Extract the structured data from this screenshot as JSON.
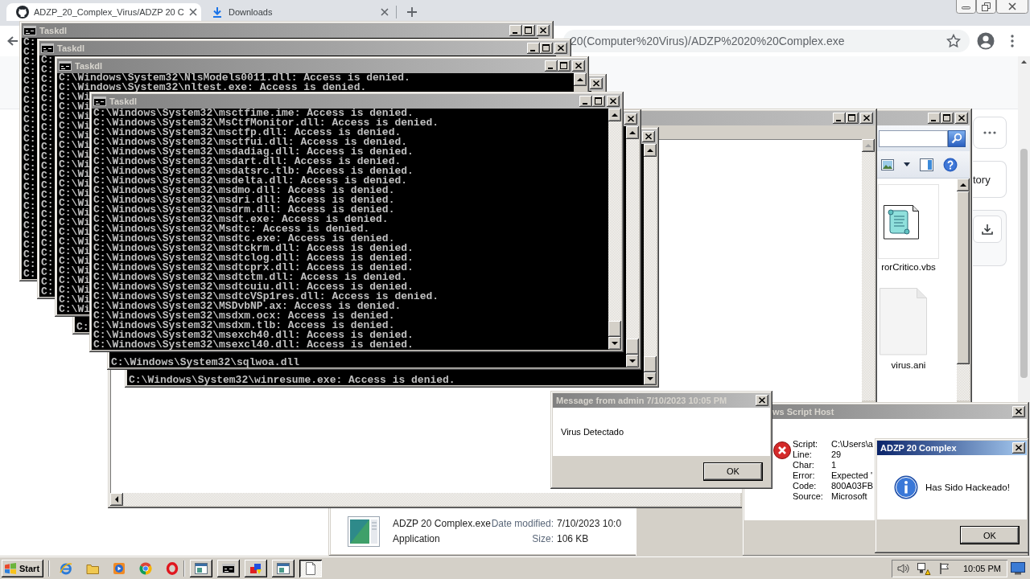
{
  "browser": {
    "tabs": [
      {
        "kind": "favicon",
        "title": "ADZP_20_Complex_Virus/ADZP 20 C",
        "selected": true
      },
      {
        "kind": "download",
        "title": "Downloads",
        "selected": false
      }
    ],
    "url": "20(Computer%20Virus)/ADZP%2020%20Complex.exe",
    "side_card": "tory"
  },
  "explorer": {
    "files": [
      {
        "kind": "script",
        "name": "rorCritico.vbs"
      },
      {
        "kind": "blank",
        "name": "virus.ani"
      }
    ],
    "details": {
      "name": "ADZP 20 Complex.exe",
      "date_label": "Date modified:",
      "date": "7/10/2023 10:0",
      "type": "Application",
      "size_label": "Size:",
      "size": "106 KB"
    }
  },
  "consoles": [
    {
      "title": "Taskdl",
      "lines": [
        "C:",
        "C:",
        "C:",
        "C:",
        "C:",
        "C:",
        "C:",
        "C:",
        "C:",
        "C:",
        "C:",
        "C:",
        "C:",
        "C:",
        "C:",
        "C:",
        "C:",
        "C:",
        "C:",
        "C:",
        "C:",
        "C:",
        "C:",
        "C:",
        "C:"
      ]
    },
    {
      "title": "Taskdl",
      "lines": [
        "C:",
        "C:",
        "C:",
        "C:",
        "C:",
        "C:",
        "C:",
        "C:",
        "C:",
        "C:",
        "C:",
        "C:",
        "C:",
        "C:",
        "C:",
        "C:",
        "C:",
        "C:",
        "C:",
        "C:",
        "C:",
        "C:",
        "C:",
        "C:",
        "C:"
      ]
    },
    {
      "title": "Taskdl",
      "lines": [
        "C:\\Windows\\System32\\NlsModels0011.dll: Access is denied.",
        "C:\\Windows\\System32\\nltest.exe: Access is denied.",
        "C:\\Wi",
        "C:\\Wi",
        "C:\\Wi",
        "C:\\Wi",
        "C:\\Wi",
        "C:\\Wi",
        "C:\\Wi",
        "C:\\Wi",
        "C:\\Wi",
        "C:\\Wi",
        "C:\\Wi",
        "C:\\Wi",
        "C:\\Wi",
        "C:\\Wi",
        "C:\\Wi",
        "C:\\Wi",
        "C:\\Wi",
        "C:\\Wi",
        "C:\\Wi",
        "C:\\Wi",
        "C:\\Wi",
        "C:\\Wi",
        "C:\\Wi"
      ]
    },
    {
      "lines": [
        "C:"
      ]
    },
    {
      "title": "Taskdl",
      "lines": [
        "C:\\Windows\\System32\\msctfime.ime: Access is denied.",
        "C:\\Windows\\System32\\MsCtfMonitor.dll: Access is denied.",
        "C:\\Windows\\System32\\msctfp.dll: Access is denied.",
        "C:\\Windows\\System32\\msctfui.dll: Access is denied.",
        "C:\\Windows\\System32\\msdadiag.dll: Access is denied.",
        "C:\\Windows\\System32\\msdart.dll: Access is denied.",
        "C:\\Windows\\System32\\msdatsrc.tlb: Access is denied.",
        "C:\\Windows\\System32\\msdelta.dll: Access is denied.",
        "C:\\Windows\\System32\\msdmo.dll: Access is denied.",
        "C:\\Windows\\System32\\msdri.dll: Access is denied.",
        "C:\\Windows\\System32\\msdrm.dll: Access is denied.",
        "C:\\Windows\\System32\\msdt.exe: Access is denied.",
        "C:\\Windows\\System32\\Msdtc: Access is denied.",
        "C:\\Windows\\System32\\msdtc.exe: Access is denied.",
        "C:\\Windows\\System32\\msdtckrm.dll: Access is denied.",
        "C:\\Windows\\System32\\msdtclog.dll: Access is denied.",
        "C:\\Windows\\System32\\msdtcprx.dll: Access is denied.",
        "C:\\Windows\\System32\\msdtctm.dll: Access is denied.",
        "C:\\Windows\\System32\\msdtcuiu.dll: Access is denied.",
        "C:\\Windows\\System32\\msdtcVSp1res.dll: Access is denied.",
        "C:\\Windows\\System32\\MSDvbNP.ax: Access is denied.",
        "C:\\Windows\\System32\\msdxm.ocx: Access is denied.",
        "C:\\Windows\\System32\\msdxm.tlb: Access is denied.",
        "C:\\Windows\\System32\\msexch40.dll: Access is denied.",
        "C:\\Windows\\System32\\msexcl40.dll: Access is denied."
      ]
    },
    {
      "lines": [
        "C:\\Windows\\System32\\sqlwoa.dll"
      ]
    },
    {
      "lines": [
        "C:\\Windows\\System32\\winresume.exe: Access is denied."
      ]
    }
  ],
  "message_box": {
    "title": "Message from admin 7/10/2023 10:05 PM",
    "text": "Virus Detectado",
    "button": "OK"
  },
  "script_error": {
    "title": "ws Script Host",
    "fields": [
      {
        "label": "Script:",
        "value": "C:\\Users\\a"
      },
      {
        "label": "Line:",
        "value": "29"
      },
      {
        "label": "Char:",
        "value": "1"
      },
      {
        "label": "Error:",
        "value": "Expected '"
      },
      {
        "label": "Code:",
        "value": "800A03FB"
      },
      {
        "label": "Source:",
        "value": "Microsoft"
      }
    ]
  },
  "alert": {
    "title": "ADZP 20 Complex",
    "text": "Has Sido Hackeado!",
    "button": "OK"
  },
  "taskbar": {
    "start": "Start",
    "tasks": [
      {
        "kind": "window",
        "selected": false
      },
      {
        "kind": "console",
        "selected": false
      },
      {
        "kind": "shapes",
        "selected": false
      },
      {
        "kind": "window",
        "selected": false
      },
      {
        "kind": "document",
        "selected": true
      }
    ],
    "clock": "10:05 PM"
  }
}
